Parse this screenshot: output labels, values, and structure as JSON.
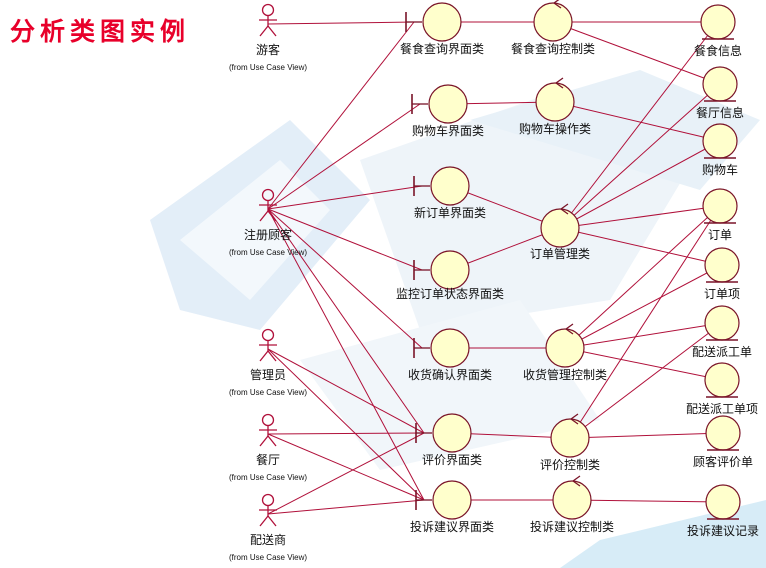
{
  "title": "分析类图实例",
  "stereotype_note": "(from Use Case View)",
  "actors": [
    {
      "id": "visitor",
      "label": "游客",
      "sub": true
    },
    {
      "id": "reg",
      "label": "注册顾客",
      "sub": true
    },
    {
      "id": "admin",
      "label": "管理员",
      "sub": true
    },
    {
      "id": "rest",
      "label": "餐厅",
      "sub": true
    },
    {
      "id": "deliv",
      "label": "配送商",
      "sub": true
    }
  ],
  "boundaries": [
    {
      "id": "b_query",
      "label": "餐食查询界面类"
    },
    {
      "id": "b_cart",
      "label": "购物车界面类"
    },
    {
      "id": "b_neworder",
      "label": "新订单界面类"
    },
    {
      "id": "b_monitor",
      "label": "监控订单状态界面类"
    },
    {
      "id": "b_confirm",
      "label": "收货确认界面类"
    },
    {
      "id": "b_eval",
      "label": "评价界面类"
    },
    {
      "id": "b_complain",
      "label": "投诉建议界面类"
    }
  ],
  "controls": [
    {
      "id": "c_query",
      "label": "餐食查询控制类"
    },
    {
      "id": "c_cart",
      "label": "购物车操作类"
    },
    {
      "id": "c_order",
      "label": "订单管理类"
    },
    {
      "id": "c_recv",
      "label": "收货管理控制类"
    },
    {
      "id": "c_eval",
      "label": "评价控制类"
    },
    {
      "id": "c_complain",
      "label": "投诉建议控制类"
    }
  ],
  "entities": [
    {
      "id": "e_meal",
      "label": "餐食信息"
    },
    {
      "id": "e_rest",
      "label": "餐厅信息"
    },
    {
      "id": "e_cart",
      "label": "购物车"
    },
    {
      "id": "e_order",
      "label": "订单"
    },
    {
      "id": "e_item",
      "label": "订单项"
    },
    {
      "id": "e_dispatch",
      "label": "配送派工单"
    },
    {
      "id": "e_dispitem",
      "label": "配送派工单项"
    },
    {
      "id": "e_review",
      "label": "顾客评价单"
    },
    {
      "id": "e_complain",
      "label": "投诉建议记录"
    }
  ],
  "edges": [
    [
      "visitor",
      "b_query"
    ],
    [
      "b_query",
      "c_query"
    ],
    [
      "c_query",
      "e_meal"
    ],
    [
      "c_query",
      "e_rest"
    ],
    [
      "reg",
      "b_query"
    ],
    [
      "reg",
      "b_cart"
    ],
    [
      "reg",
      "b_neworder"
    ],
    [
      "reg",
      "b_monitor"
    ],
    [
      "reg",
      "b_confirm"
    ],
    [
      "reg",
      "b_eval"
    ],
    [
      "reg",
      "b_complain"
    ],
    [
      "b_cart",
      "c_cart"
    ],
    [
      "c_cart",
      "e_cart"
    ],
    [
      "b_neworder",
      "c_order"
    ],
    [
      "b_monitor",
      "c_order"
    ],
    [
      "c_order",
      "e_meal"
    ],
    [
      "c_order",
      "e_rest"
    ],
    [
      "c_order",
      "e_cart"
    ],
    [
      "c_order",
      "e_order"
    ],
    [
      "c_order",
      "e_item"
    ],
    [
      "b_confirm",
      "c_recv"
    ],
    [
      "c_recv",
      "e_order"
    ],
    [
      "c_recv",
      "e_item"
    ],
    [
      "c_recv",
      "e_dispatch"
    ],
    [
      "c_recv",
      "e_dispitem"
    ],
    [
      "admin",
      "b_eval"
    ],
    [
      "admin",
      "b_complain"
    ],
    [
      "rest",
      "b_eval"
    ],
    [
      "rest",
      "b_complain"
    ],
    [
      "deliv",
      "b_eval"
    ],
    [
      "deliv",
      "b_complain"
    ],
    [
      "b_eval",
      "c_eval"
    ],
    [
      "c_eval",
      "e_review"
    ],
    [
      "c_eval",
      "e_order"
    ],
    [
      "c_eval",
      "e_dispatch"
    ],
    [
      "b_complain",
      "c_complain"
    ],
    [
      "c_complain",
      "e_complain"
    ]
  ]
}
